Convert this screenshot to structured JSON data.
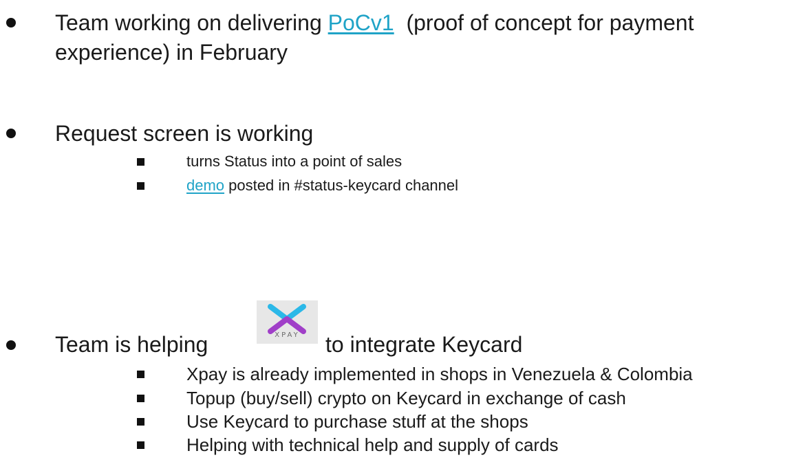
{
  "sections": [
    {
      "text_before": "Team working on delivering ",
      "link": "PoCv1",
      "text_after": "  (proof of concept for payment",
      "line2": "experience) in February",
      "subitems": []
    },
    {
      "text": "Request screen is working",
      "subitems": [
        {
          "text": "turns Status into a point of sales"
        },
        {
          "link": "demo",
          "text_after": " posted in #status-keycard channel"
        }
      ]
    },
    {
      "text_before": "Team is helping",
      "logo": {
        "label": "XPAY",
        "icon": "xpay-logo",
        "colors": {
          "top_stroke": "#2bb8e8",
          "bottom_stroke": "#a03fc8",
          "background": "#e7e7e7"
        }
      },
      "text_after": "to integrate Keycard",
      "subitems": [
        {
          "text": "Xpay is already implemented in shops in Venezuela & Colombia"
        },
        {
          "text": "Topup (buy/sell) crypto on Keycard in exchange of cash"
        },
        {
          "text": "Use Keycard to purchase stuff at the shops"
        },
        {
          "text": "Helping with technical help and supply of cards"
        }
      ]
    }
  ],
  "link_color": "#1fa3c7"
}
